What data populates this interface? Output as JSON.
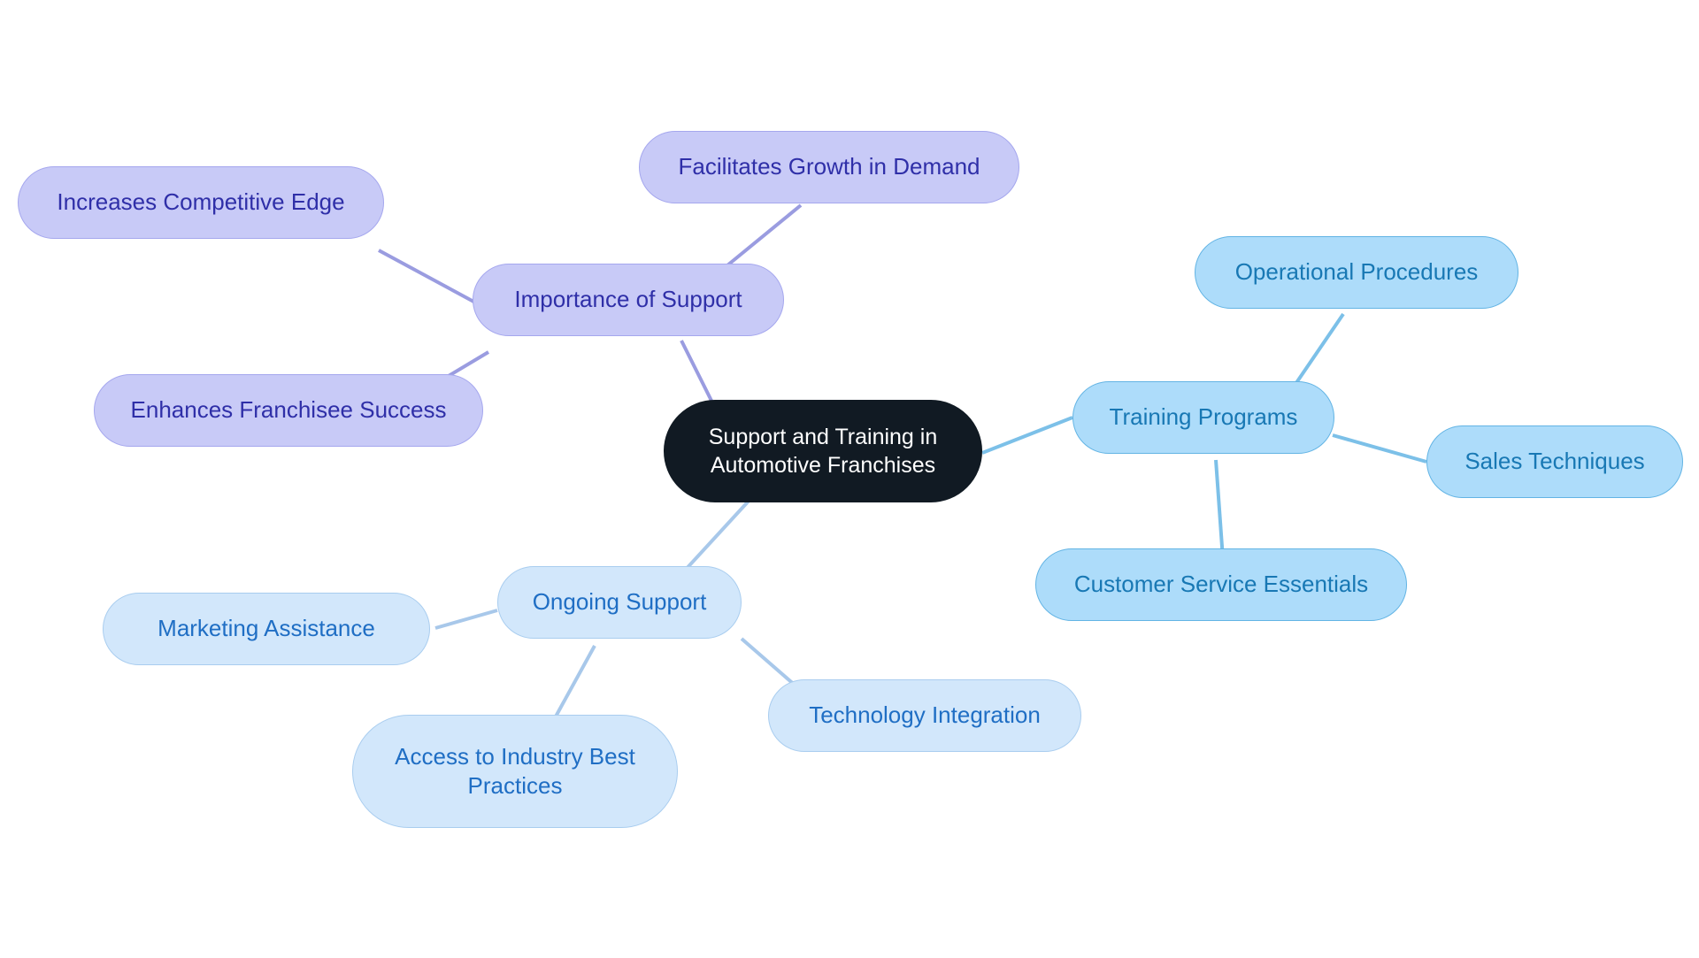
{
  "diagram": {
    "type": "mind-map",
    "title": "Support and Training in Automotive Franchises",
    "background_color": "#ffffff",
    "root": {
      "label": "Support and Training in\nAutomotive Franchises",
      "fill": "#111a23",
      "text_color": "#ffffff"
    },
    "branches": [
      {
        "id": "importance-of-support",
        "label": "Importance of Support",
        "fill": "#c8caf7",
        "border": "#a5a7ee",
        "text_color": "#2f2fa8",
        "edge_color": "#9a9ce0",
        "children": [
          {
            "id": "increases-competitive-edge",
            "label": "Increases Competitive Edge"
          },
          {
            "id": "facilitates-growth-in-demand",
            "label": "Facilitates Growth in Demand"
          },
          {
            "id": "enhances-franchisee-success",
            "label": "Enhances Franchisee Success"
          }
        ]
      },
      {
        "id": "training-programs",
        "label": "Training Programs",
        "fill": "#addcfa",
        "border": "#63b4e4",
        "text_color": "#1878b4",
        "edge_color": "#7cc0e8",
        "children": [
          {
            "id": "operational-procedures",
            "label": "Operational Procedures"
          },
          {
            "id": "sales-techniques",
            "label": "Sales Techniques"
          },
          {
            "id": "customer-service-essentials",
            "label": "Customer Service Essentials"
          }
        ]
      },
      {
        "id": "ongoing-support",
        "label": "Ongoing Support",
        "fill": "#d2e7fb",
        "border": "#a9cdef",
        "text_color": "#1f6ec4",
        "edge_color": "#a8c8ea",
        "children": [
          {
            "id": "marketing-assistance",
            "label": "Marketing Assistance"
          },
          {
            "id": "access-to-industry-best-practices",
            "label": "Access to Industry Best\nPractices"
          },
          {
            "id": "technology-integration",
            "label": "Technology Integration"
          }
        ]
      }
    ]
  }
}
